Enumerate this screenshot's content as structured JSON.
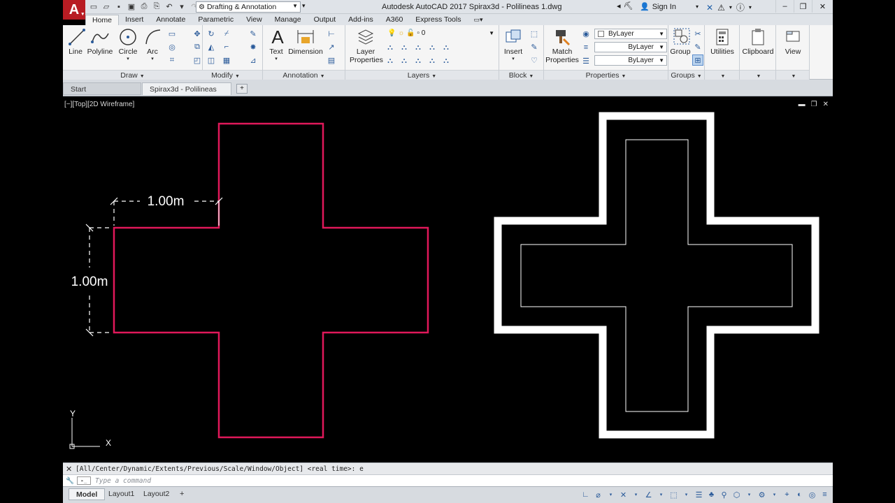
{
  "titlebar": {
    "app_logo": "A",
    "workspace": "Drafting & Annotation",
    "title": "Autodesk AutoCAD 2017    Spirax3d - Polilineas 1.dwg",
    "sign_in": "Sign In",
    "controls": [
      "–",
      "❐",
      "✕"
    ]
  },
  "ribbon_tabs": [
    "Home",
    "Insert",
    "Annotate",
    "Parametric",
    "View",
    "Manage",
    "Output",
    "Add-ins",
    "A360",
    "Express Tools"
  ],
  "ribbon": {
    "draw": {
      "title": "Draw",
      "buttons": [
        "Line",
        "Polyline",
        "Circle",
        "Arc"
      ]
    },
    "modify": {
      "title": "Modify"
    },
    "annotation": {
      "title": "Annotation",
      "buttons": [
        "Text",
        "Dimension"
      ]
    },
    "layers": {
      "title": "Layers",
      "button": [
        "Layer",
        "Properties"
      ],
      "layer_value": "0"
    },
    "block": {
      "title": "Block",
      "button": "Insert"
    },
    "properties": {
      "title": "Properties",
      "button": [
        "Match",
        "Properties"
      ],
      "color": "ByLayer",
      "linetype": "ByLayer",
      "lineweight": "ByLayer"
    },
    "groups": {
      "title": "Groups",
      "button": "Group"
    },
    "utilities": {
      "label": "Utilities"
    },
    "clipboard": {
      "label": "Clipboard"
    },
    "view": {
      "label": "View"
    }
  },
  "doc_tabs": {
    "start": "Start",
    "drawing": "Spirax3d - Polilineas 1*"
  },
  "viewport": {
    "label": "[−][Top][2D Wireframe]"
  },
  "drawing": {
    "dim_horizontal": "1.00m",
    "dim_vertical": "1.00m",
    "ucs_x": "X",
    "ucs_y": "Y",
    "colors": {
      "cross": "#e0185a",
      "dims": "#ffffff",
      "outline": "#ffffff"
    }
  },
  "command": {
    "history": "[All/Center/Dynamic/Extents/Previous/Scale/Window/Object] <real time>: e",
    "placeholder": "Type a command"
  },
  "status": {
    "tabs": [
      "Model",
      "Layout1",
      "Layout2"
    ]
  }
}
